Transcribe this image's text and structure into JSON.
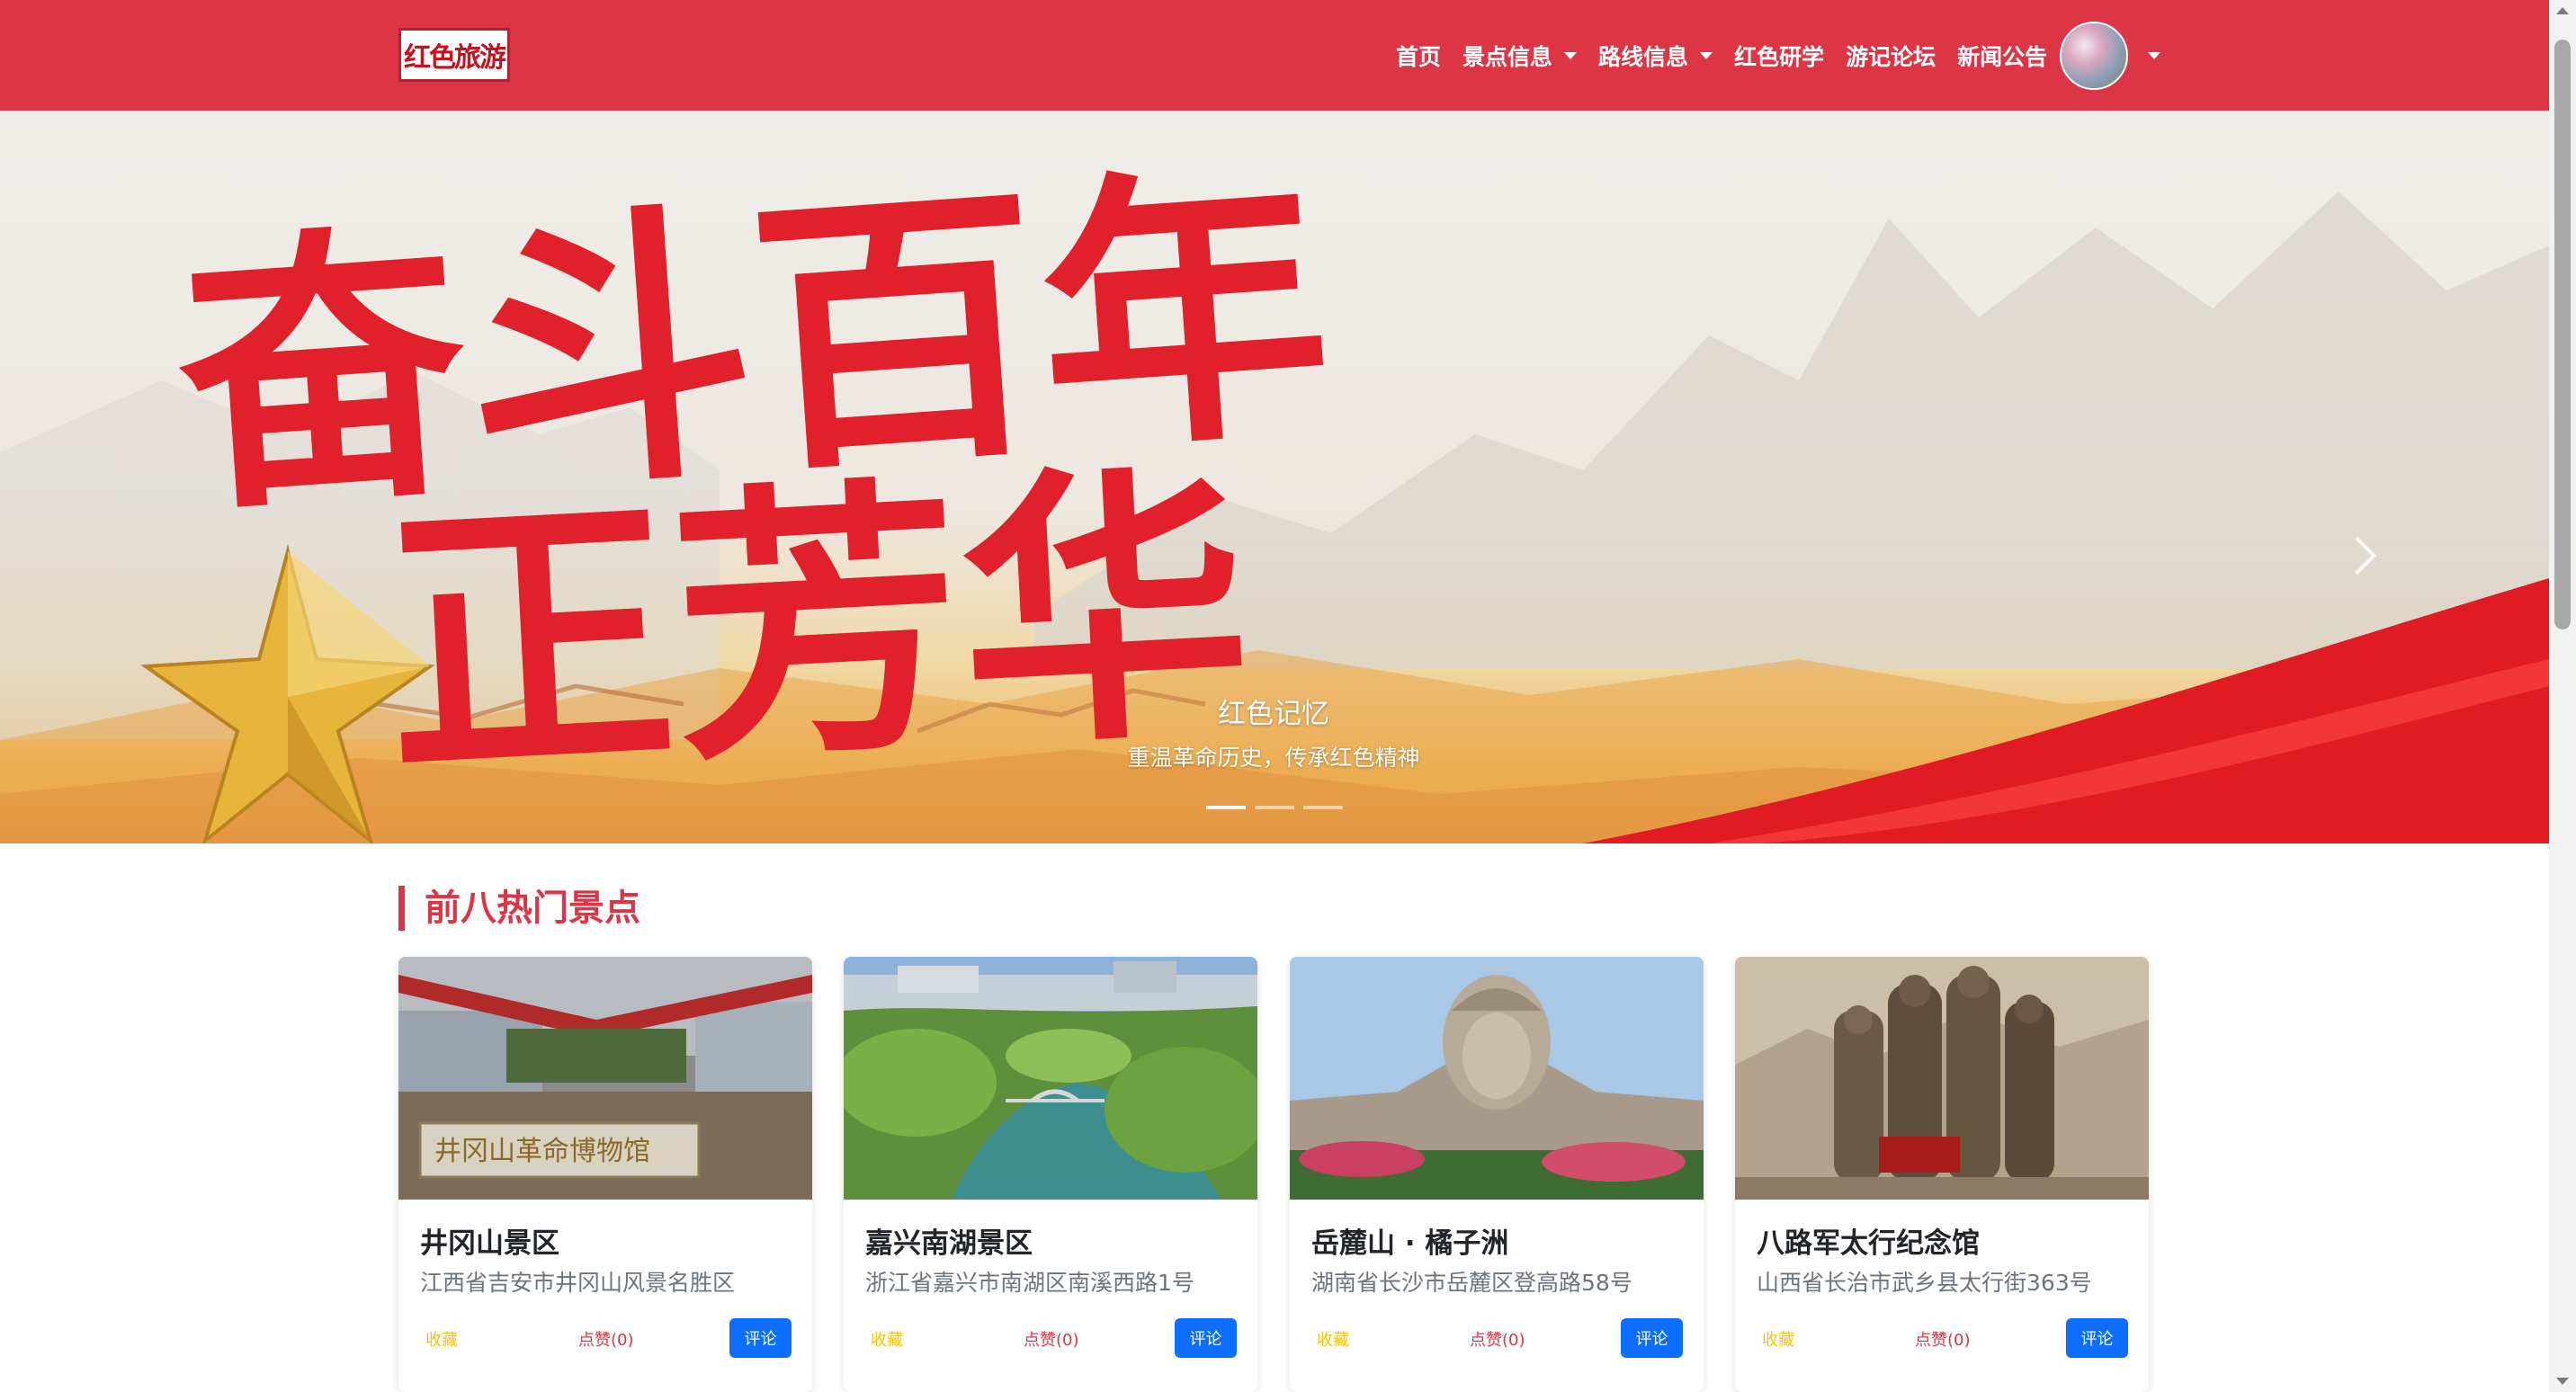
{
  "brand": {
    "logo_text": "红色旅游"
  },
  "nav": {
    "home": "首页",
    "scenic": "景点信息",
    "routes": "路线信息",
    "study": "红色研学",
    "forum": "游记论坛",
    "news": "新闻公告"
  },
  "hero": {
    "banner_line1": "奋斗百年",
    "banner_line2": "正芳华",
    "caption_title": "红色记忆",
    "caption_subtitle": "重温革命历史，传承红色精神",
    "slide_count": 3,
    "active_slide": 1
  },
  "section": {
    "title": "前八热门景点"
  },
  "cards": [
    {
      "name": "井冈山景区",
      "address": "江西省吉安市井冈山风景名胜区",
      "fav": "收藏",
      "like": "点赞(0)",
      "comment": "评论",
      "sign": "井冈山革命博物馆"
    },
    {
      "name": "嘉兴南湖景区",
      "address": "浙江省嘉兴市南湖区南溪西路1号",
      "fav": "收藏",
      "like": "点赞(0)",
      "comment": "评论"
    },
    {
      "name": "岳麓山 · 橘子洲",
      "address": "湖南省长沙市岳麓区登高路58号",
      "fav": "收藏",
      "like": "点赞(0)",
      "comment": "评论"
    },
    {
      "name": "八路军太行纪念馆",
      "address": "山西省长治市武乡县太行街363号",
      "fav": "收藏",
      "like": "点赞(0)",
      "comment": "评论"
    }
  ],
  "colors": {
    "brand_red": "#dc3545",
    "primary_blue": "#0d6efd",
    "fav_yellow": "#ffc107"
  }
}
